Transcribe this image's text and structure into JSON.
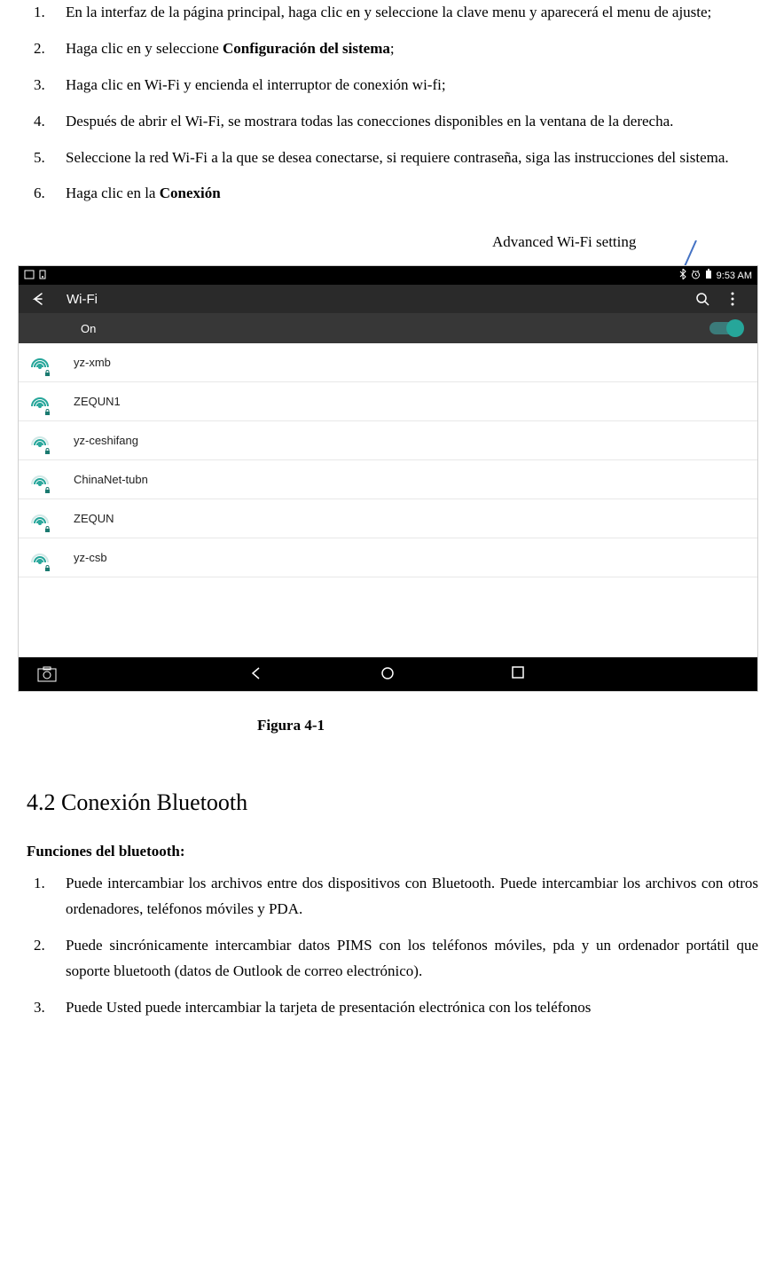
{
  "instructions_top": [
    {
      "num": "1.",
      "text_parts": [
        {
          "t": "En la interfaz de la página principal, haga clic en y seleccione la clave menu y aparecerá el menu de ajuste;"
        }
      ]
    },
    {
      "num": "2.",
      "text_parts": [
        {
          "t": "Haga clic en y seleccione "
        },
        {
          "t": "Configuración del sistema",
          "bold": true
        },
        {
          "t": ";"
        }
      ]
    },
    {
      "num": "3.",
      "text_parts": [
        {
          "t": "Haga clic en Wi-Fi y encienda el interruptor de conexión wi-fi;"
        }
      ]
    },
    {
      "num": "4.",
      "text_parts": [
        {
          "t": "Después de abrir   el Wi-Fi, se mostrara todas las conecciones disponibles en la ventana de la derecha."
        }
      ]
    },
    {
      "num": "5.",
      "text_parts": [
        {
          "t": "Seleccione la red Wi-Fi a la que se desea conectarse, si requiere contraseña, siga las instrucciones del sistema."
        }
      ]
    },
    {
      "num": "6.",
      "text_parts": [
        {
          "t": "Haga clic en la "
        },
        {
          "t": "Conexión",
          "bold": true
        }
      ]
    }
  ],
  "callout_label": "Advanced Wi-Fi setting",
  "screenshot": {
    "statusbar": {
      "time": "9:53 AM"
    },
    "appbar": {
      "title": "Wi-Fi"
    },
    "toggle": {
      "state_label": "On"
    },
    "networks": [
      {
        "name": "yz-xmb",
        "strength": 3,
        "secured": true
      },
      {
        "name": "ZEQUN1",
        "strength": 3,
        "secured": true
      },
      {
        "name": "yz-ceshifang",
        "strength": 2,
        "secured": true
      },
      {
        "name": "ChinaNet-tubn",
        "strength": 2,
        "secured": true
      },
      {
        "name": "ZEQUN",
        "strength": 2,
        "secured": true
      },
      {
        "name": "yz-csb",
        "strength": 2,
        "secured": true
      }
    ]
  },
  "figure_caption": "Figura   4-1",
  "section_heading": "4.2 Conexión Bluetooth",
  "subheading": "Funciones del bluetooth:",
  "bluetooth_functions": [
    {
      "num": "1.",
      "text": "Puede intercambiar los archivos entre dos dispositivos con Bluetooth. Puede intercambiar los archivos con otros ordenadores, teléfonos móviles y PDA."
    },
    {
      "num": "2.",
      "text": "Puede sincrónicamente intercambiar datos PIMS con los teléfonos móviles, pda y un ordenador portátil que soporte bluetooth (datos de Outlook de correo electrónico)."
    },
    {
      "num": "3.",
      "text": "Puede Usted puede intercambiar la tarjeta de presentación electrónica con los teléfonos"
    }
  ]
}
